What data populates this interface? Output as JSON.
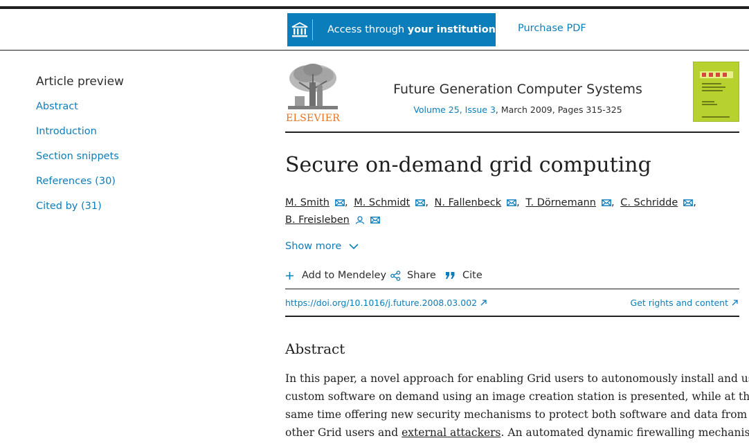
{
  "header": {
    "institution_prefix": "Access through ",
    "institution_bold": "your institution",
    "purchase_label": "Purchase PDF"
  },
  "sidebar": {
    "heading": "Article preview",
    "items": [
      {
        "label": "Abstract"
      },
      {
        "label": "Introduction"
      },
      {
        "label": "Section snippets"
      },
      {
        "label": "References (30)"
      },
      {
        "label": "Cited by (31)"
      }
    ]
  },
  "journal": {
    "publisher": "ELSEVIER",
    "name": "Future Generation Computer Systems",
    "volume_issue": "Volume 25, Issue 3",
    "date_pages": ", March 2009, Pages 315-325"
  },
  "article": {
    "title": "Secure on-demand grid computing",
    "authors": [
      {
        "name": "M. Smith"
      },
      {
        "name": "M. Schmidt"
      },
      {
        "name": "N. Fallenbeck"
      },
      {
        "name": "T. Dörnemann"
      },
      {
        "name": "C. Schridde"
      },
      {
        "name": "B. Freisleben"
      }
    ],
    "author_separator": ",",
    "show_more": "Show more",
    "actions": {
      "mendeley": "Add to Mendeley",
      "share": "Share",
      "cite": "Cite"
    },
    "doi": "https://doi.org/10.1016/j.future.2008.03.002",
    "rights": "Get rights and content"
  },
  "abstract": {
    "heading": "Abstract",
    "line1": "In this paper, a novel approach for enabling Grid users to autonomously install and use",
    "line2": "custom software on demand using an image creation station is presented, while at the",
    "line3": "same time offering new security mechanisms to protect both software and data from",
    "line4_a": "other Grid users and ",
    "line4_link": "external attackers",
    "line4_b": ". An automated dynamic firewalling mechanism"
  },
  "colors": {
    "accent": "#0c7dbb",
    "publisher_orange": "#e9711c",
    "cover_green": "#b7d22e"
  },
  "icons": [
    "institution-icon",
    "mail-icon",
    "person-icon",
    "chevron-down-icon",
    "plus-icon",
    "share-icon",
    "quote-icon",
    "external-arrow-icon"
  ]
}
